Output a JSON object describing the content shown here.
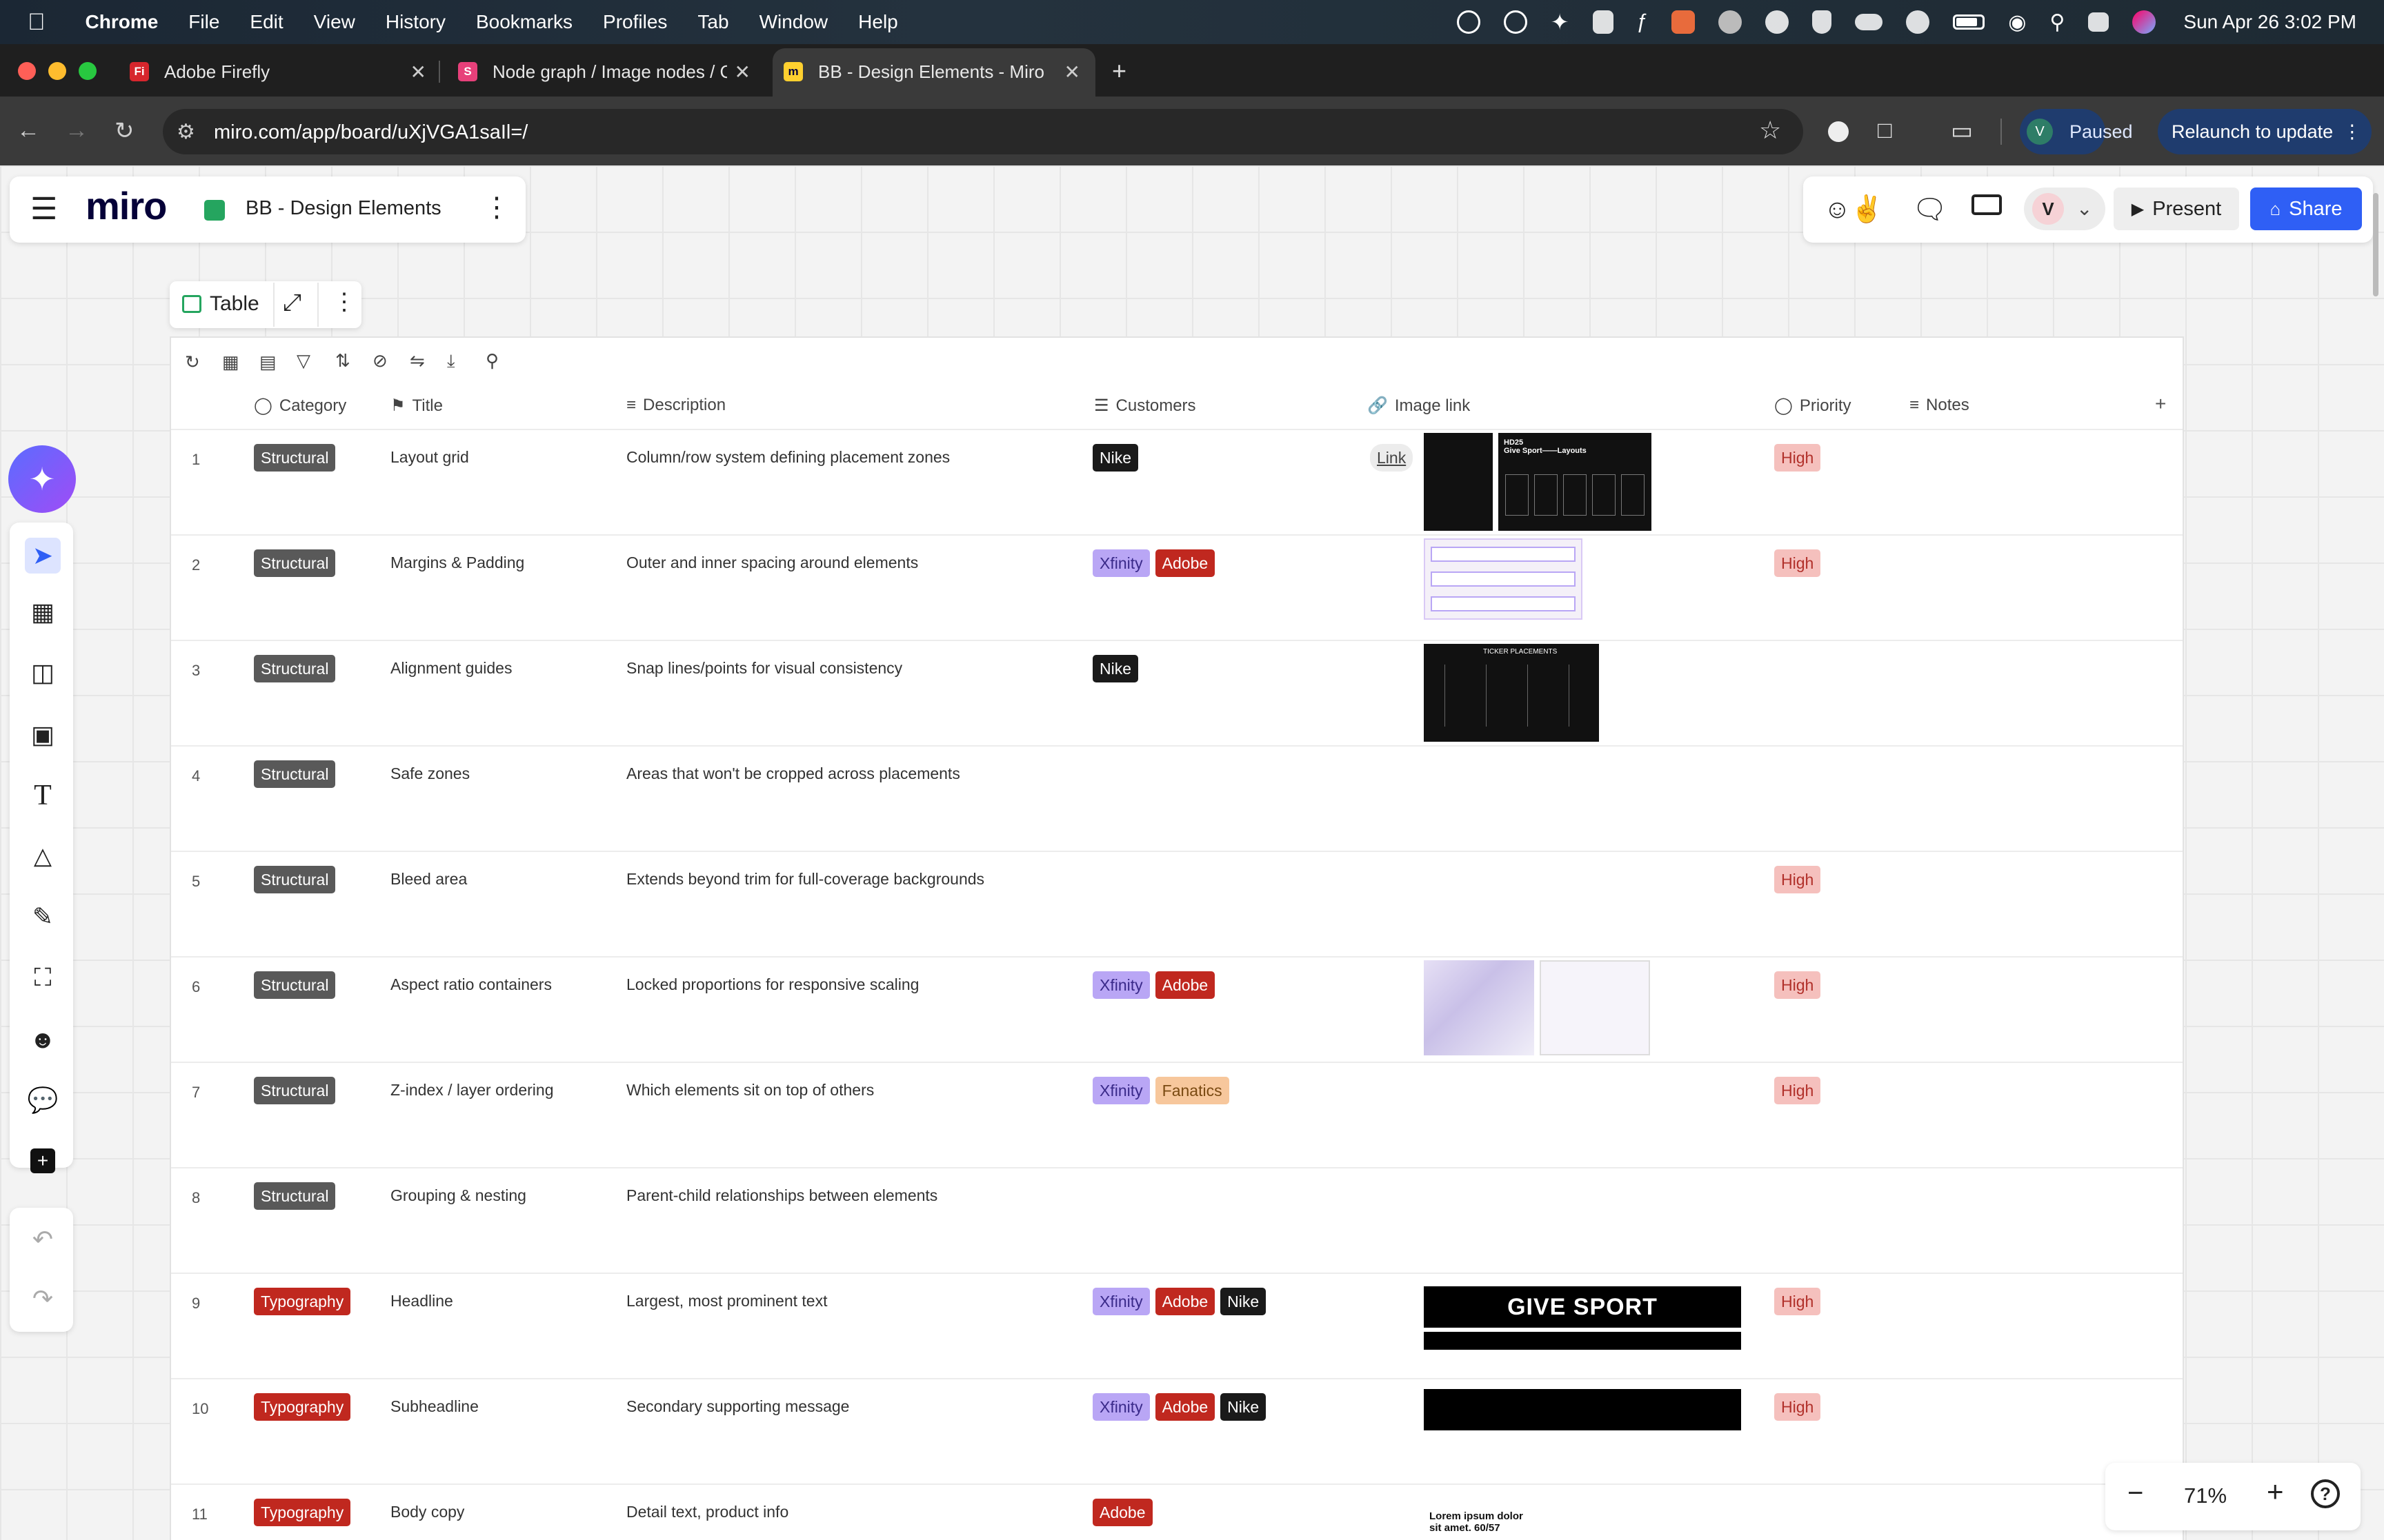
{
  "menubar": {
    "app": "Chrome",
    "items": [
      "File",
      "Edit",
      "View",
      "History",
      "Bookmarks",
      "Profiles",
      "Tab",
      "Window",
      "Help"
    ],
    "datetime": "Sun Apr 26  3:02 PM"
  },
  "browser": {
    "tabs": [
      {
        "title": "Adobe Firefly",
        "favicon": "Fi"
      },
      {
        "title": "Node graph / Image nodes / C",
        "favicon": "S"
      },
      {
        "title": "BB - Design Elements - Miro",
        "favicon": "m"
      }
    ],
    "url": "miro.com/app/board/uXjVGA1saIl=/",
    "profile_initial": "V",
    "paused_label": "Paused",
    "relaunch_label": "Relaunch to update"
  },
  "miro": {
    "logo": "miro",
    "board_name": "BB - Design Elements",
    "avatar_initial": "V",
    "present_label": "Present",
    "share_label": "Share",
    "zoom": "71%",
    "help": "?"
  },
  "table": {
    "widget_label": "Table",
    "columns": [
      "Category",
      "Title",
      "Description",
      "Customers",
      "Image link",
      "Priority",
      "Notes"
    ],
    "rows": [
      {
        "num": "1",
        "category": "Structural",
        "title": "Layout grid",
        "description": "Column/row system defining placement zones",
        "customers": [
          "Nike"
        ],
        "link": "Link",
        "priority": "High"
      },
      {
        "num": "2",
        "category": "Structural",
        "title": "Margins & Padding",
        "description": "Outer and inner spacing around elements",
        "customers": [
          "Xfinity",
          "Adobe"
        ],
        "link": "",
        "priority": "High"
      },
      {
        "num": "3",
        "category": "Structural",
        "title": "Alignment guides",
        "description": "Snap lines/points for visual consistency",
        "customers": [
          "Nike"
        ],
        "link": "",
        "priority": ""
      },
      {
        "num": "4",
        "category": "Structural",
        "title": "Safe zones",
        "description": "Areas that won't be cropped across placements",
        "customers": [],
        "link": "",
        "priority": ""
      },
      {
        "num": "5",
        "category": "Structural",
        "title": "Bleed area",
        "description": "Extends beyond trim for full-coverage backgrounds",
        "customers": [],
        "link": "",
        "priority": "High"
      },
      {
        "num": "6",
        "category": "Structural",
        "title": "Aspect ratio containers",
        "description": "Locked proportions for responsive scaling",
        "customers": [
          "Xfinity",
          "Adobe"
        ],
        "link": "",
        "priority": "High"
      },
      {
        "num": "7",
        "category": "Structural",
        "title": "Z-index / layer ordering",
        "description": "Which elements sit on top of others",
        "customers": [
          "Xfinity",
          "Fanatics"
        ],
        "link": "",
        "priority": "High"
      },
      {
        "num": "8",
        "category": "Structural",
        "title": "Grouping & nesting",
        "description": "Parent-child relationships between elements",
        "customers": [],
        "link": "",
        "priority": ""
      },
      {
        "num": "9",
        "category": "Typography",
        "title": "Headline",
        "description": "Largest, most prominent text",
        "customers": [
          "Xfinity",
          "Adobe",
          "Nike"
        ],
        "link": "",
        "priority": "High"
      },
      {
        "num": "10",
        "category": "Typography",
        "title": "Subheadline",
        "description": "Secondary supporting message",
        "customers": [
          "Xfinity",
          "Adobe",
          "Nike"
        ],
        "link": "",
        "priority": "High"
      },
      {
        "num": "11",
        "category": "Typography",
        "title": "Body copy",
        "description": "Detail text, product info",
        "customers": [
          "Adobe"
        ],
        "link": "",
        "priority": ""
      }
    ]
  },
  "thumbnails": {
    "give_sport": "GIVE SPORT",
    "hd25": "HD25\nGive Sport——Layouts",
    "ticker": "TICKER PLACEMENTS",
    "lorem": "Lorem ipsum dolor sit amet. 60/57"
  },
  "colors": {
    "structural": "#595959",
    "typography": "#c0281f",
    "nike": "#1a1a1a",
    "xfinity": "#b9a6f5",
    "adobe": "#c0281f",
    "fanatics": "#f7c79c",
    "high_bg": "#f5c0bd",
    "share": "#2f5ff5"
  }
}
